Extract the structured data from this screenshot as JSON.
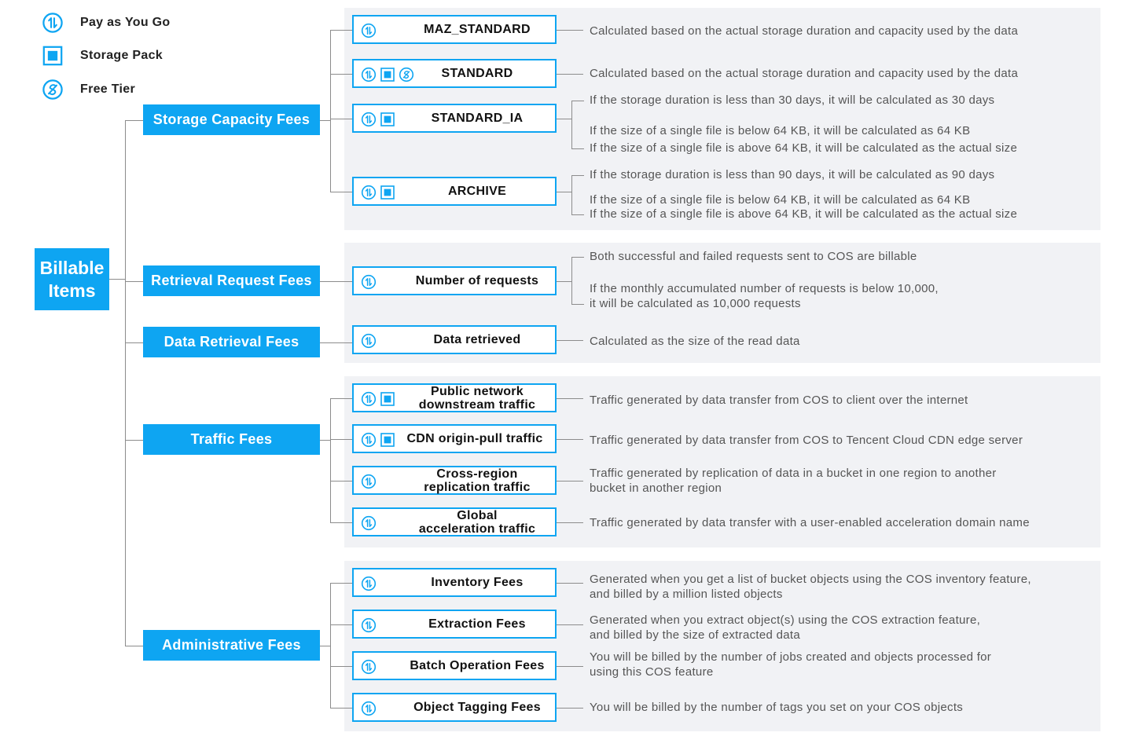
{
  "legend": [
    {
      "icon": "pay-as-you-go-icon",
      "label": "Pay as You Go"
    },
    {
      "icon": "storage-pack-icon",
      "label": "Storage Pack"
    },
    {
      "icon": "free-tier-icon",
      "label": "Free Tier"
    }
  ],
  "root": {
    "line1": "Billable",
    "line2": "Items"
  },
  "categories": [
    {
      "label": "Storage Capacity Fees",
      "items": [
        {
          "label": [
            "MAZ_STANDARD"
          ],
          "icons": [
            "pay-as-you-go-icon"
          ],
          "desc": [
            "Calculated based on the actual storage duration and capacity used by the data"
          ]
        },
        {
          "label": [
            "STANDARD"
          ],
          "icons": [
            "pay-as-you-go-icon",
            "storage-pack-icon",
            "free-tier-icon"
          ],
          "desc": [
            "Calculated based on the actual storage duration and capacity used by the data"
          ]
        },
        {
          "label": [
            "STANDARD_IA"
          ],
          "icons": [
            "pay-as-you-go-icon",
            "storage-pack-icon"
          ],
          "desc": [
            "If the storage duration is less than 30 days, it will be calculated as 30 days",
            "If the size of a single file is below 64 KB, it will be calculated as 64 KB",
            "If the size of a single file is above 64 KB, it will be calculated as the actual size"
          ]
        },
        {
          "label": [
            "ARCHIVE"
          ],
          "icons": [
            "pay-as-you-go-icon",
            "storage-pack-icon"
          ],
          "desc": [
            "If the storage duration is less than 90 days, it will be calculated as 90 days",
            "If the size of a single file is below 64 KB, it will be calculated as 64 KB",
            "If the size of a single file is above 64 KB, it will be calculated as the actual size"
          ]
        }
      ]
    },
    {
      "label": "Retrieval Request Fees",
      "items": [
        {
          "label": [
            "Number of requests"
          ],
          "icons": [
            "pay-as-you-go-icon"
          ],
          "desc": [
            "Both successful and failed requests sent to COS are billable",
            "If the monthly accumulated number of requests is below 10,000,",
            "it will be calculated as 10,000 requests"
          ]
        }
      ]
    },
    {
      "label": "Data Retrieval Fees",
      "items": [
        {
          "label": [
            "Data retrieved"
          ],
          "icons": [
            "pay-as-you-go-icon"
          ],
          "desc": [
            "Calculated as the size of the read data"
          ]
        }
      ]
    },
    {
      "label": "Traffic Fees",
      "items": [
        {
          "label": [
            "Public network",
            "downstream traffic"
          ],
          "icons": [
            "pay-as-you-go-icon",
            "storage-pack-icon"
          ],
          "desc": [
            "Traffic generated by data transfer from COS to client over the internet"
          ]
        },
        {
          "label": [
            "CDN origin-pull traffic"
          ],
          "icons": [
            "pay-as-you-go-icon",
            "storage-pack-icon"
          ],
          "desc": [
            "Traffic generated by data transfer from COS to Tencent Cloud CDN edge server"
          ]
        },
        {
          "label": [
            "Cross-region",
            "replication traffic"
          ],
          "icons": [
            "pay-as-you-go-icon"
          ],
          "desc": [
            "Traffic generated by replication of data in a bucket in one region to another",
            "bucket in another region"
          ]
        },
        {
          "label": [
            "Global",
            "acceleration traffic"
          ],
          "icons": [
            "pay-as-you-go-icon"
          ],
          "desc": [
            "Traffic generated by data transfer with a user-enabled acceleration domain name"
          ]
        }
      ]
    },
    {
      "label": "Administrative Fees",
      "items": [
        {
          "label": [
            "Inventory Fees"
          ],
          "icons": [
            "pay-as-you-go-icon"
          ],
          "desc": [
            "Generated when you get a list of bucket objects using the COS inventory feature,",
            "and billed by a million listed objects"
          ]
        },
        {
          "label": [
            "Extraction Fees"
          ],
          "icons": [
            "pay-as-you-go-icon"
          ],
          "desc": [
            "Generated when you extract object(s) using the COS extraction feature,",
            "and billed by the size of extracted data"
          ]
        },
        {
          "label": [
            "Batch Operation Fees"
          ],
          "icons": [
            "pay-as-you-go-icon"
          ],
          "desc": [
            "You will be billed by the number of jobs created and objects processed for",
            "using this COS feature"
          ]
        },
        {
          "label": [
            "Object Tagging Fees"
          ],
          "icons": [
            "pay-as-you-go-icon"
          ],
          "desc": [
            "You will be billed by the number of tags you set on your COS objects"
          ]
        }
      ]
    }
  ],
  "colors": {
    "accent": "#0ea5f2",
    "group_background": "#f1f2f5",
    "connector": "#8c8c8c"
  }
}
